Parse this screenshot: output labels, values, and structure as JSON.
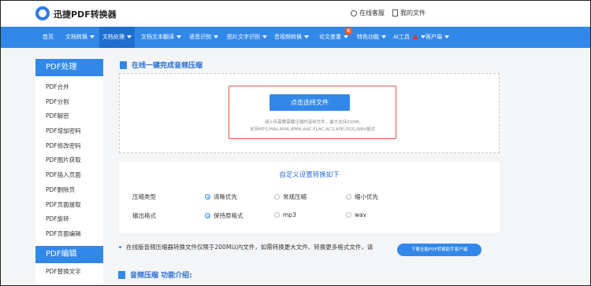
{
  "header": {
    "logo_text": "迅捷PDF转换器",
    "service_label": "在线客服",
    "my_files_label": "我的文件"
  },
  "nav": {
    "items": [
      {
        "label": "首页"
      },
      {
        "label": "文档转换"
      },
      {
        "label": "文档处理"
      },
      {
        "label": "文档文本翻译"
      },
      {
        "label": "语音识别"
      },
      {
        "label": "图片文字识别"
      },
      {
        "label": "音视频转换"
      },
      {
        "label": "论文查重",
        "badge": "新"
      },
      {
        "label": "特色功能"
      },
      {
        "label": "AI工具"
      },
      {
        "label": "客户端"
      }
    ],
    "active_index": 2,
    "accent": "#3288e8"
  },
  "sidebar": {
    "section1_title": "PDF处理",
    "items": [
      {
        "label": "PDF合并"
      },
      {
        "label": "PDF分割"
      },
      {
        "label": "PDF解密"
      },
      {
        "label": "PDF增加密码"
      },
      {
        "label": "PDF修改密码"
      },
      {
        "label": "PDF图片获取"
      },
      {
        "label": "PDF插入页面"
      },
      {
        "label": "PDF删除页"
      },
      {
        "label": "PDF页面提取"
      },
      {
        "label": "PDF旋转"
      },
      {
        "label": "PDF页面编辑"
      }
    ],
    "section2_title": "PDF编辑",
    "items2": [
      {
        "label": "PDF替换文字"
      }
    ]
  },
  "main": {
    "title": "在线一键完成音频压缩",
    "upload": {
      "button_label": "点击选择文件",
      "tip_line1": "请上传需要需要压缩的音频文件，最大支持200M,",
      "tip_line2": "支持MP3,MAV,M4A,WMA,AAC,FLAC,AC3,APE,OGG,WAV格式"
    },
    "settings": {
      "title": "自定义设置转换如下",
      "compress_label": "压缩类型",
      "compress_options": [
        "清晰优先",
        "常规压缩",
        "缩小优先"
      ],
      "compress_selected": 0,
      "format_label": "输出格式",
      "format_options": [
        "保持原格式",
        "mp3",
        "wav"
      ],
      "format_selected": 0
    },
    "notice": "在线版音频压缩器转换文件仅限于200M以内文件，如需转换更大文件、转换更多格式文件，请",
    "download_label": "下载全能PDF转换助手客户端",
    "intro_title": "音频压缩 功能介绍:"
  }
}
